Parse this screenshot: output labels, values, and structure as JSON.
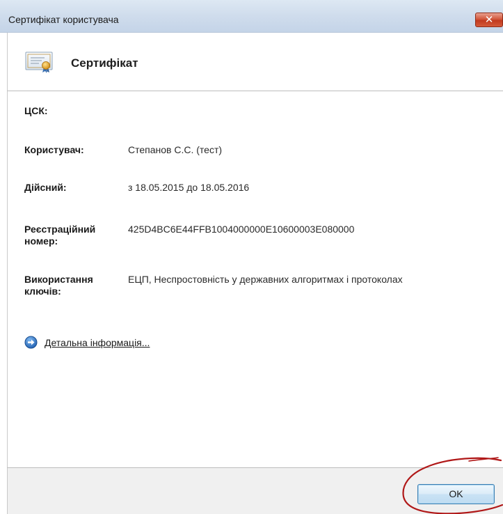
{
  "window": {
    "title": "Сертифікат користувача",
    "close_label": "✕"
  },
  "header": {
    "title": "Сертифікат",
    "icon": "certificate-icon"
  },
  "fields": {
    "csk": {
      "label": "ЦСК:",
      "value": ""
    },
    "user": {
      "label": "Користувач:",
      "value": "Степанов С.С. (тест)"
    },
    "valid": {
      "label": "Дійсний:",
      "value": "з 18.05.2015 до 18.05.2016"
    },
    "reg_number": {
      "label_line1": "Реєстраційний",
      "label_line2": "номер:",
      "value": "425D4BC6E44FFB1004000000E10600003E080000"
    },
    "key_usage": {
      "label_line1": "Використання",
      "label_line2": "ключів:",
      "value": "ЕЦП, Неспростовність у державних алгоритмах і протоколах"
    }
  },
  "details": {
    "label": "Детальна інформація...",
    "icon": "arrow-right-circle-icon"
  },
  "footer": {
    "ok_label": "OK"
  },
  "colors": {
    "titlebar": "#cfdcec",
    "close_button": "#c13a1f",
    "ok_border": "#3c7fb1",
    "annotation": "#b01818"
  }
}
